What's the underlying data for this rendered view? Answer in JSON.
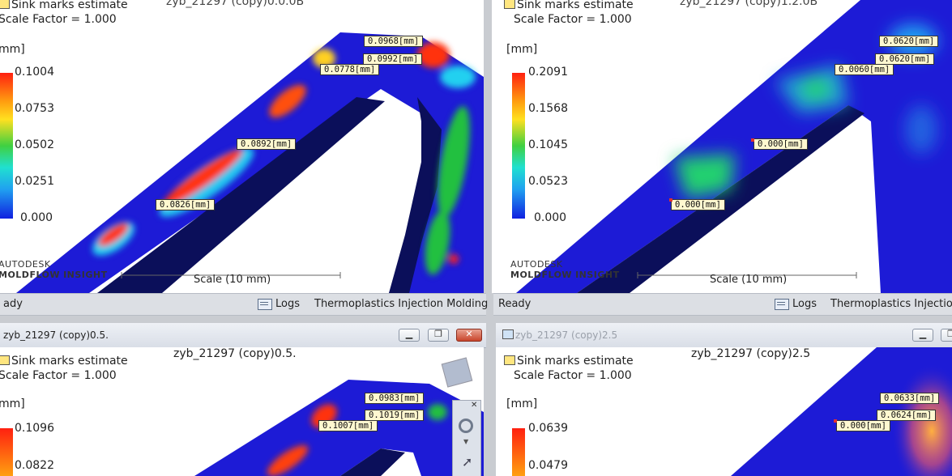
{
  "colors": {
    "plastic": "#1d1bd6",
    "dark_face": "#0a0f55",
    "bg": "#ffffff",
    "hot": "#ff3010",
    "warm": "#ffd020",
    "mid": "#20d040",
    "cool": "#20d0f0"
  },
  "common": {
    "sink_title": "Sink marks estimate",
    "scale_factor": "Scale Factor = 1.000",
    "unit_tl": "mm]",
    "unit_tr": "[mm]",
    "scale_label": "Scale (10 mm)",
    "autodesk": "AUTODESK",
    "moldflow": "MOLDFLOW",
    "insight": "INSIGHT",
    "logs": "Logs",
    "mode_full": "Thermoplastics Injection Molding",
    "mode_short": "Thermoplastics Injection",
    "ready_clipped": "ady",
    "ready": "Ready"
  },
  "panes": {
    "tl": {
      "header_clip": "zyb_21297 (copy)0.0.0B",
      "legend": [
        "0.1004",
        "0.0753",
        "0.0502",
        "0.0251",
        "0.000"
      ],
      "tags": [
        "0.0968[mm]",
        "0.0992[mm]",
        "0.0778[mm]",
        "0.0892[mm]",
        "0.0826[mm]"
      ]
    },
    "tr": {
      "header_clip": "zyb_21297 (copy)1.2.0B",
      "legend": [
        "0.2091",
        "0.1568",
        "0.1045",
        "0.0523",
        "0.000"
      ],
      "tags": [
        "0.0620[mm]",
        "0.0620[mm]",
        "0.0060[mm]",
        "0.000[mm]",
        "0.000[mm]"
      ]
    },
    "bl": {
      "window_title": "zyb_21297 (copy)0.5.",
      "header": "zyb_21297 (copy)0.5.",
      "legend": [
        "0.1096",
        "0.0822"
      ],
      "tags": [
        "0.0983[mm]",
        "0.1019[mm]",
        "0.1007[mm]"
      ]
    },
    "br": {
      "window_title": "zyb_21297 (copy)2.5",
      "header": "zyb_21297 (copy)2.5",
      "legend": [
        "0.0639",
        "0.0479"
      ],
      "tags": [
        "0.0633[mm]",
        "0.0624[mm]",
        "0.000[mm]"
      ]
    }
  }
}
